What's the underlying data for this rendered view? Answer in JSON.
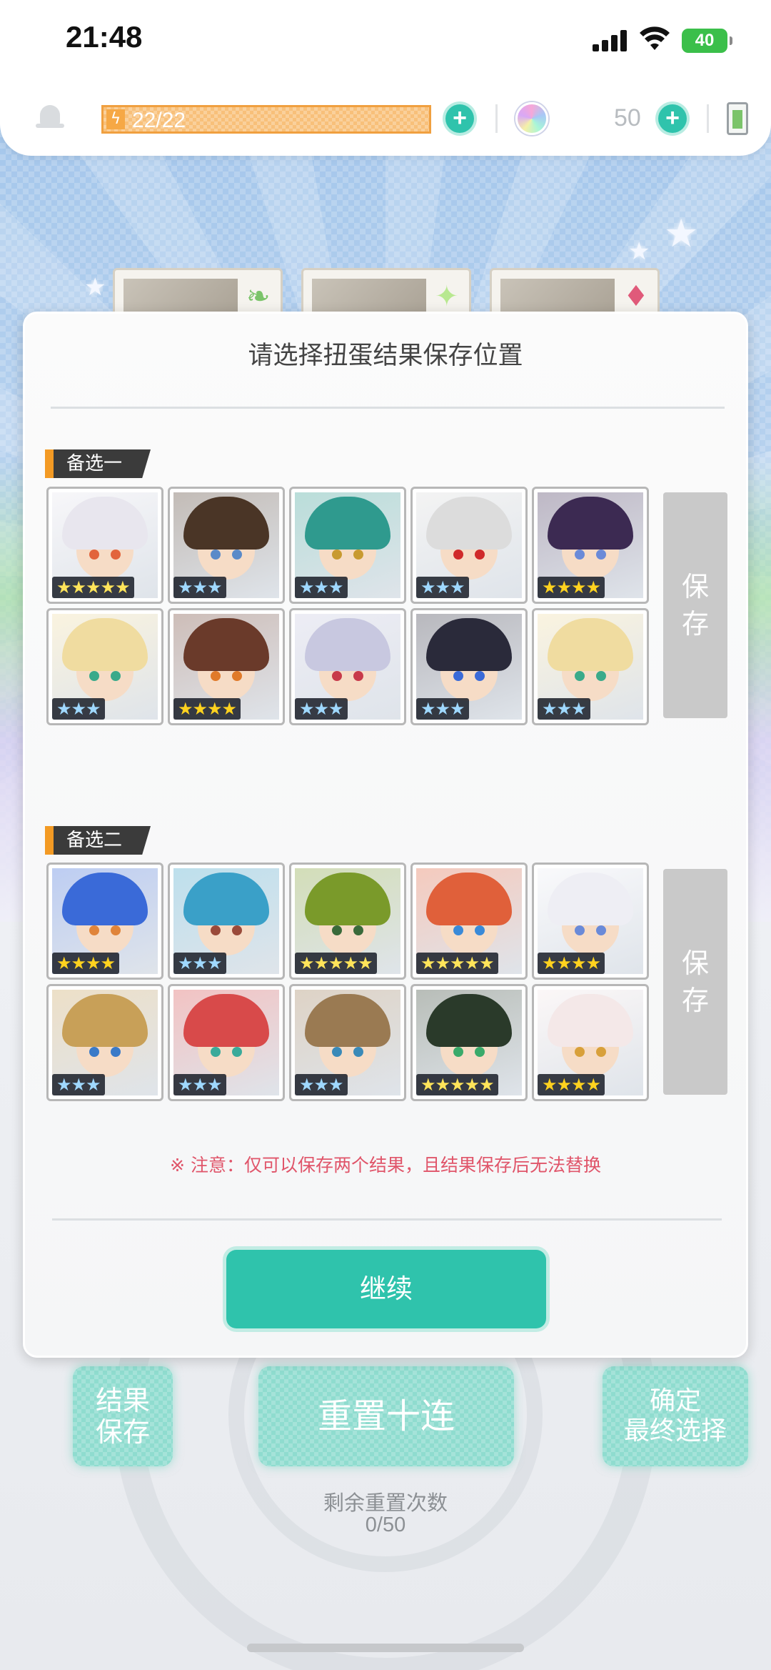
{
  "status_bar": {
    "time": "21:48",
    "battery": "40"
  },
  "topbar": {
    "stamina": "22/22",
    "gems": "50"
  },
  "dialog": {
    "title": "请选择扭蛋结果保存位置",
    "option1": {
      "label": "备选一",
      "save_line1": "保",
      "save_line2": "存",
      "cards": [
        {
          "stars": "★★★★★",
          "rarity": 5,
          "hair": "#e8e6ee",
          "eye": "#e2643c"
        },
        {
          "stars": "★★★",
          "rarity": 3,
          "hair": "#4a3526",
          "eye": "#5a8ac8"
        },
        {
          "stars": "★★★",
          "rarity": 3,
          "hair": "#2f9a8e",
          "eye": "#c89a30"
        },
        {
          "stars": "★★★",
          "rarity": 3,
          "hair": "#dcdcdc",
          "eye": "#d02a2a"
        },
        {
          "stars": "★★★★",
          "rarity": 4,
          "hair": "#3c2a52",
          "eye": "#6a8ad8"
        },
        {
          "stars": "★★★",
          "rarity": 3,
          "hair": "#f0dca0",
          "eye": "#3aaa8a"
        },
        {
          "stars": "★★★★",
          "rarity": 4,
          "hair": "#6a3a2a",
          "eye": "#e07a2a"
        },
        {
          "stars": "★★★",
          "rarity": 3,
          "hair": "#c8c8e0",
          "eye": "#c83a4a"
        },
        {
          "stars": "★★★",
          "rarity": 3,
          "hair": "#2a2a3a",
          "eye": "#3a6ad8"
        },
        {
          "stars": "★★★",
          "rarity": 3,
          "hair": "#f0dca0",
          "eye": "#3aaa8a"
        }
      ]
    },
    "option2": {
      "label": "备选二",
      "save_line1": "保",
      "save_line2": "存",
      "cards": [
        {
          "stars": "★★★★",
          "rarity": 4,
          "hair": "#3a6ad8",
          "eye": "#e0843a"
        },
        {
          "stars": "★★★",
          "rarity": 3,
          "hair": "#3aa0c8",
          "eye": "#9a4a3a"
        },
        {
          "stars": "★★★★★",
          "rarity": 5,
          "hair": "#7a9a2a",
          "eye": "#3a6a3a"
        },
        {
          "stars": "★★★★★",
          "rarity": 5,
          "hair": "#e0603a",
          "eye": "#3a8ad8"
        },
        {
          "stars": "★★★★",
          "rarity": 4,
          "hair": "#eeeef4",
          "eye": "#6a8ad8"
        },
        {
          "stars": "★★★",
          "rarity": 3,
          "hair": "#c8a058",
          "eye": "#3a7ac8"
        },
        {
          "stars": "★★★",
          "rarity": 3,
          "hair": "#d84a4a",
          "eye": "#3aaa9a"
        },
        {
          "stars": "★★★",
          "rarity": 3,
          "hair": "#9a7a52",
          "eye": "#3a8ab8"
        },
        {
          "stars": "★★★★★",
          "rarity": 5,
          "hair": "#2a3a2a",
          "eye": "#3aaa6a"
        },
        {
          "stars": "★★★★",
          "rarity": 4,
          "hair": "#f4e8e8",
          "eye": "#d8a03a"
        }
      ]
    },
    "notice": "※ 注意：仅可以保存两个结果，且结果保存后无法替换",
    "continue_label": "继续"
  },
  "controls": {
    "result_save_line1": "结果",
    "result_save_line2": "保存",
    "reset_label": "重置十连",
    "confirm_line1": "确定",
    "confirm_line2": "最终选择",
    "remaining_label": "剩余重置次数",
    "remaining_value": "0/50"
  },
  "colors": {
    "accent": "#2fc3ac",
    "notice": "#e0556a",
    "tag_bg": "#3b3b3b",
    "tag_accent": "#f39a24",
    "save_disabled": "#c9c9c9"
  }
}
